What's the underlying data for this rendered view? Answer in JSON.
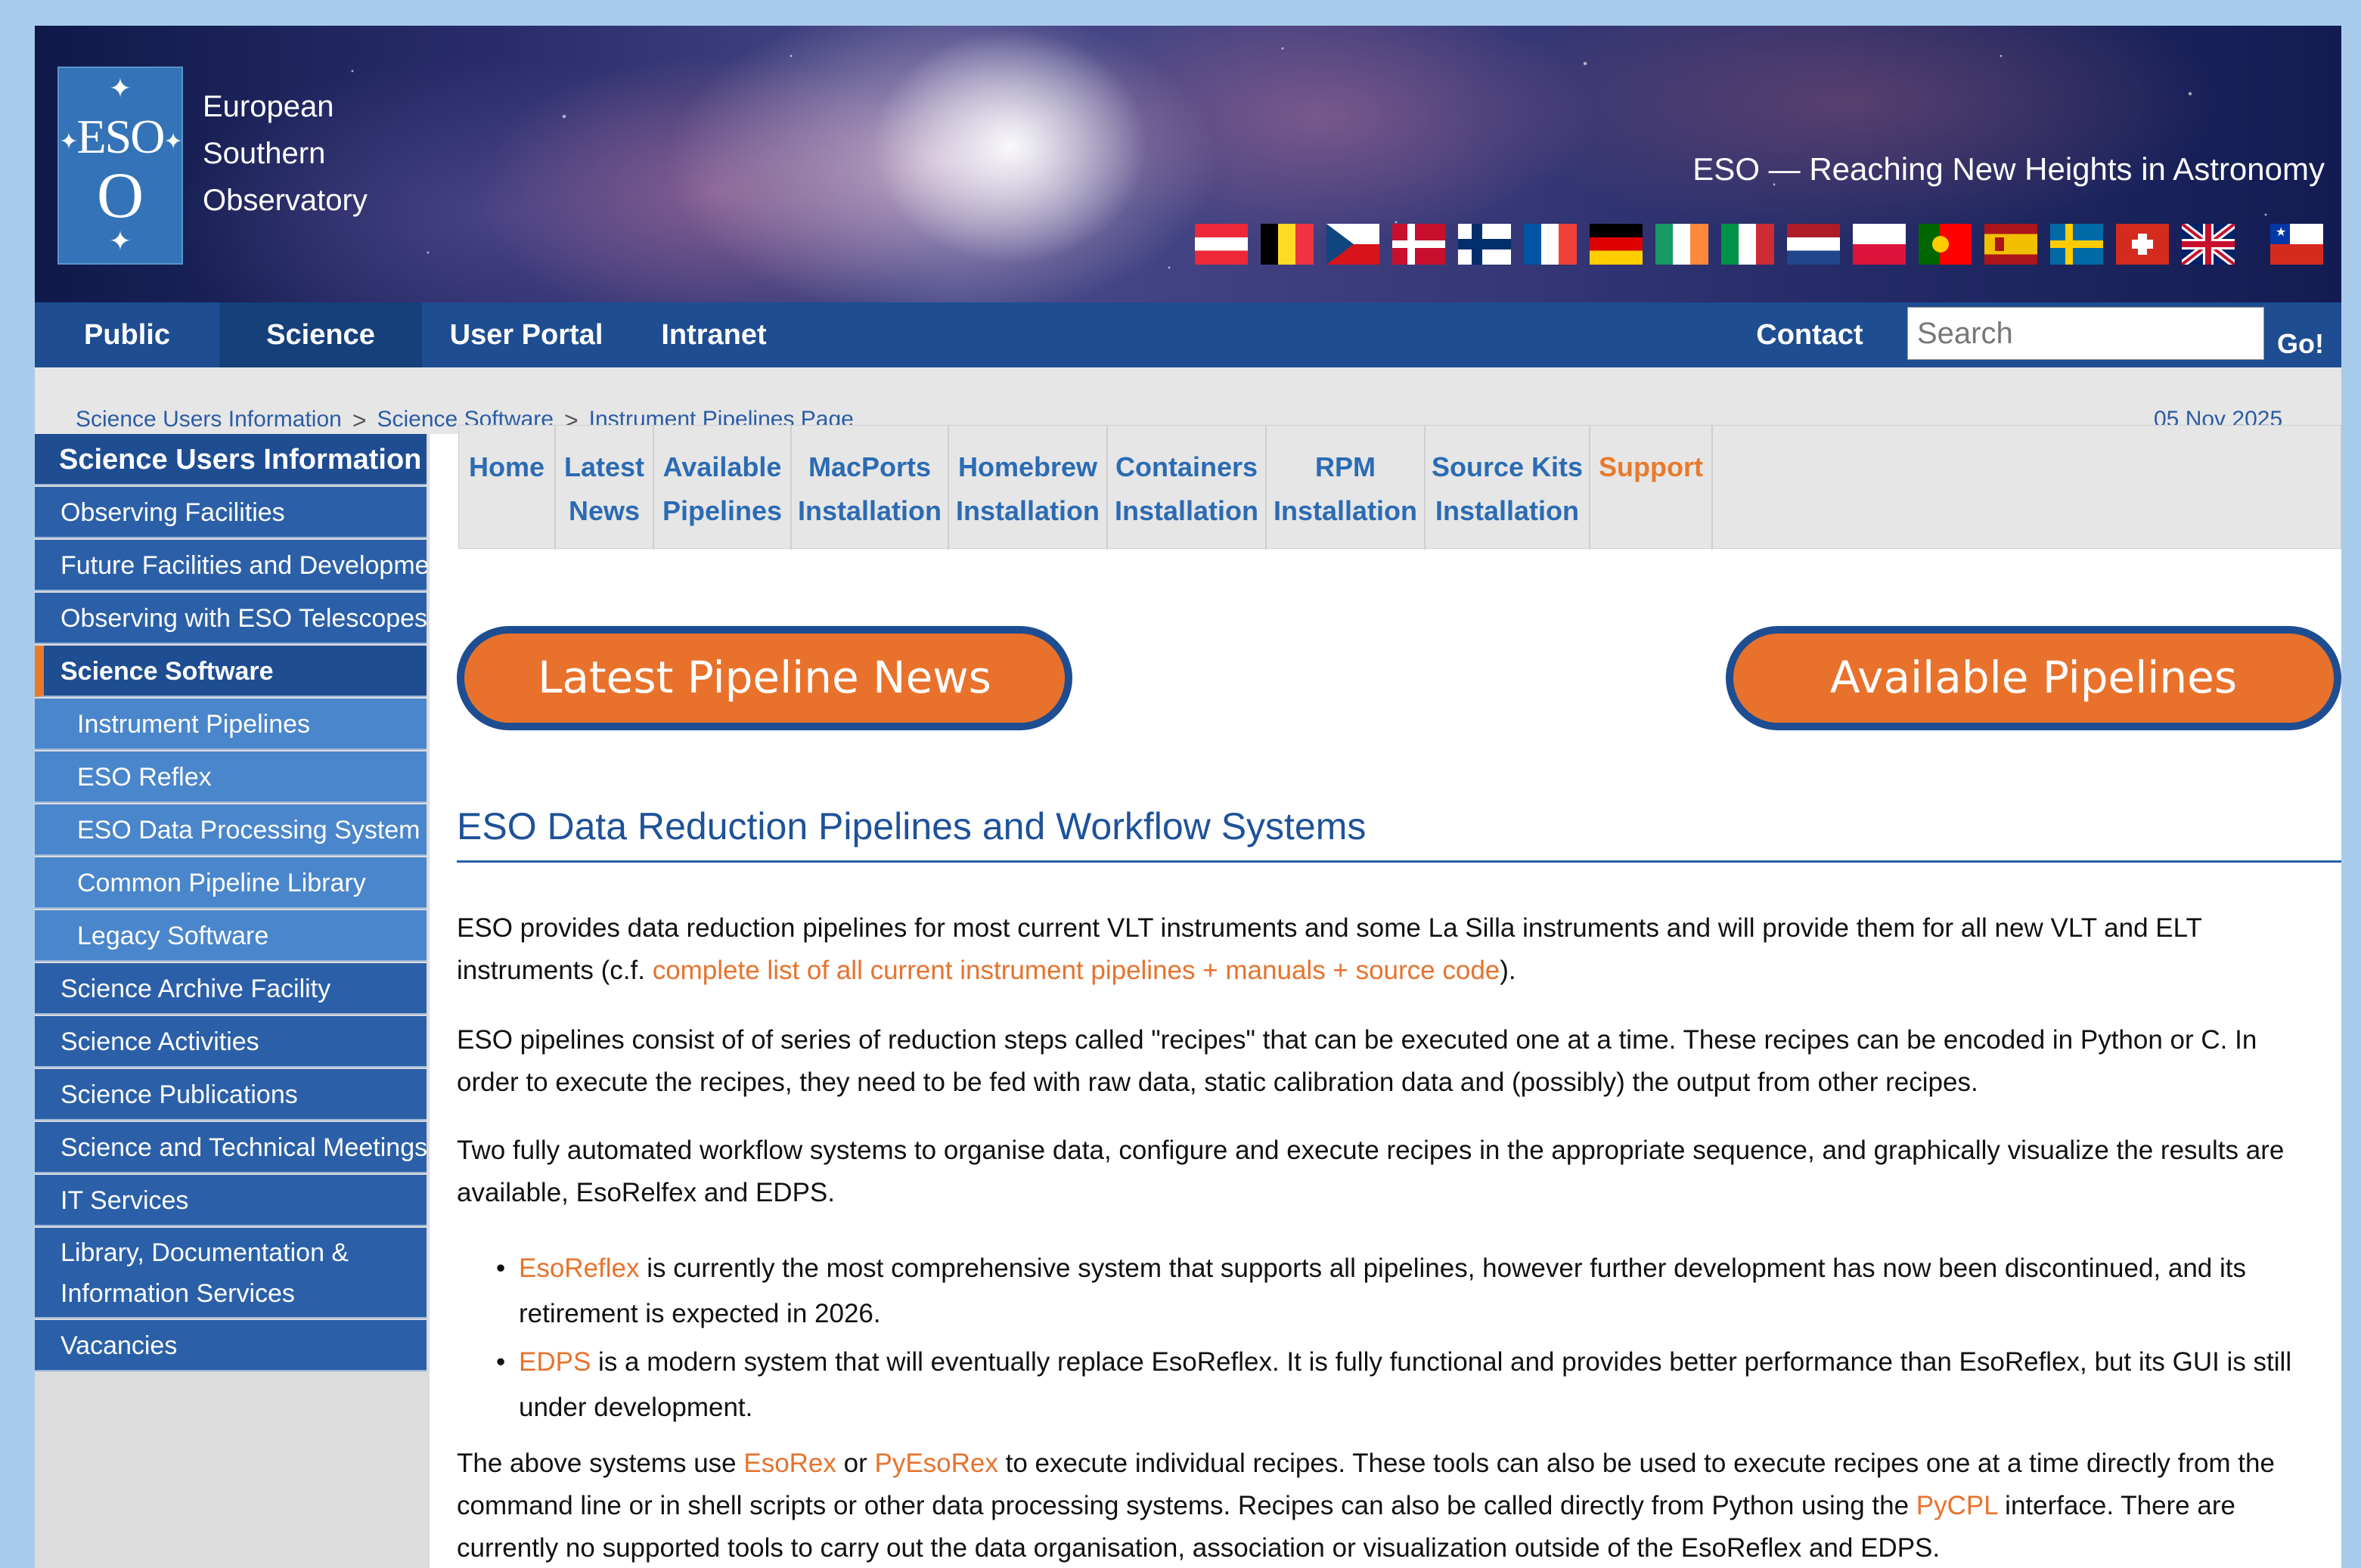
{
  "org": {
    "logo_text": "ESO",
    "name_lines": [
      "European",
      "Southern",
      "Observatory"
    ],
    "tagline": "ESO — Reaching New Heights in Astronomy"
  },
  "flags": [
    "austria",
    "belgium",
    "czechia",
    "denmark",
    "finland",
    "france",
    "germany",
    "ireland",
    "italy",
    "netherlands",
    "poland",
    "portugal",
    "spain",
    "sweden",
    "switzerland",
    "united-kingdom",
    "chile"
  ],
  "nav": {
    "public": "Public",
    "science": "Science",
    "user_portal": "User Portal",
    "intranet": "Intranet",
    "contact": "Contact",
    "search_placeholder": "Search",
    "go": "Go!"
  },
  "breadcrumb": [
    "Science Users Information",
    "Science Software",
    "Instrument Pipelines Page"
  ],
  "date": "05 Nov 2025",
  "sidebar": {
    "title": "Science Users Information",
    "items": [
      "Observing Facilities",
      "Future Facilities and Development",
      "Observing with ESO Telescopes",
      "Science Software",
      "Instrument Pipelines",
      "ESO Reflex",
      "ESO Data Processing System",
      "Common Pipeline Library",
      "Legacy Software",
      "Science Archive Facility",
      "Science Activities",
      "Science Publications",
      "Science and Technical Meetings",
      "IT Services",
      "Library, Documentation & Information Services",
      "Vacancies"
    ]
  },
  "tabs": [
    {
      "l1": "Home",
      "l2": ""
    },
    {
      "l1": "Latest",
      "l2": "News"
    },
    {
      "l1": "Available",
      "l2": "Pipelines"
    },
    {
      "l1": "MacPorts",
      "l2": "Installation"
    },
    {
      "l1": "Homebrew",
      "l2": "Installation"
    },
    {
      "l1": "Containers",
      "l2": "Installation"
    },
    {
      "l1": "RPM",
      "l2": "Installation"
    },
    {
      "l1": "Source Kits",
      "l2": "Installation"
    },
    {
      "l1": "Support",
      "l2": ""
    }
  ],
  "buttons": {
    "latest_news": "Latest Pipeline News",
    "available": "Available Pipelines"
  },
  "content": {
    "heading": "ESO Data Reduction Pipelines and Workflow Systems",
    "p1_text": "ESO provides data reduction pipelines for most current VLT instruments and some La Silla instruments and will provide them for all new VLT and ELT instruments (c.f.",
    "p1_link": "complete list of all current instrument pipelines + manuals + source code",
    "p1_end": ").",
    "p2": "ESO pipelines consist of of series of reduction steps called \"recipes\" that can be executed one at a time. These recipes can be encoded in Python or C. In order to execute the recipes, they need to be fed with raw data, static calibration data and (possibly) the output from other recipes.",
    "p3": "Two fully automated workflow systems to organise data, configure and execute recipes in the appropriate sequence, and graphically visualize the results are available, EsoRelfex and EDPS.",
    "b1_link": "EsoReflex",
    "b1_text": " is currently the most comprehensive system that supports all pipelines, however further development has now been discontinued, and its retirement is expected in 2026.",
    "b2_link": "EDPS",
    "b2_text": " is a modern system that will eventually replace EsoReflex. It is fully functional and provides better performance than EsoReflex, but its GUI is still under development.",
    "p4_a": "The above systems use ",
    "p4_link1": "EsoRex",
    "p4_b": " or ",
    "p4_link2": "PyEsoRex",
    "p4_c": " to execute individual recipes. These tools can also be used to execute recipes one at a time directly from the command line or in shell scripts or other data processing systems. Recipes can also be called directly from Python using the ",
    "p4_link3": "PyCPL",
    "p4_d": " interface. There are currently no supported tools to carry out the data organisation, association or visualization outside of the EsoReflex and EDPS."
  },
  "colors": {
    "nav_blue": "#1e4d91",
    "sidebar_blue": "#2b60a8",
    "sub_blue": "#4a86cb",
    "accent_orange": "#e8722c",
    "link_blue": "#2b6bb3"
  }
}
